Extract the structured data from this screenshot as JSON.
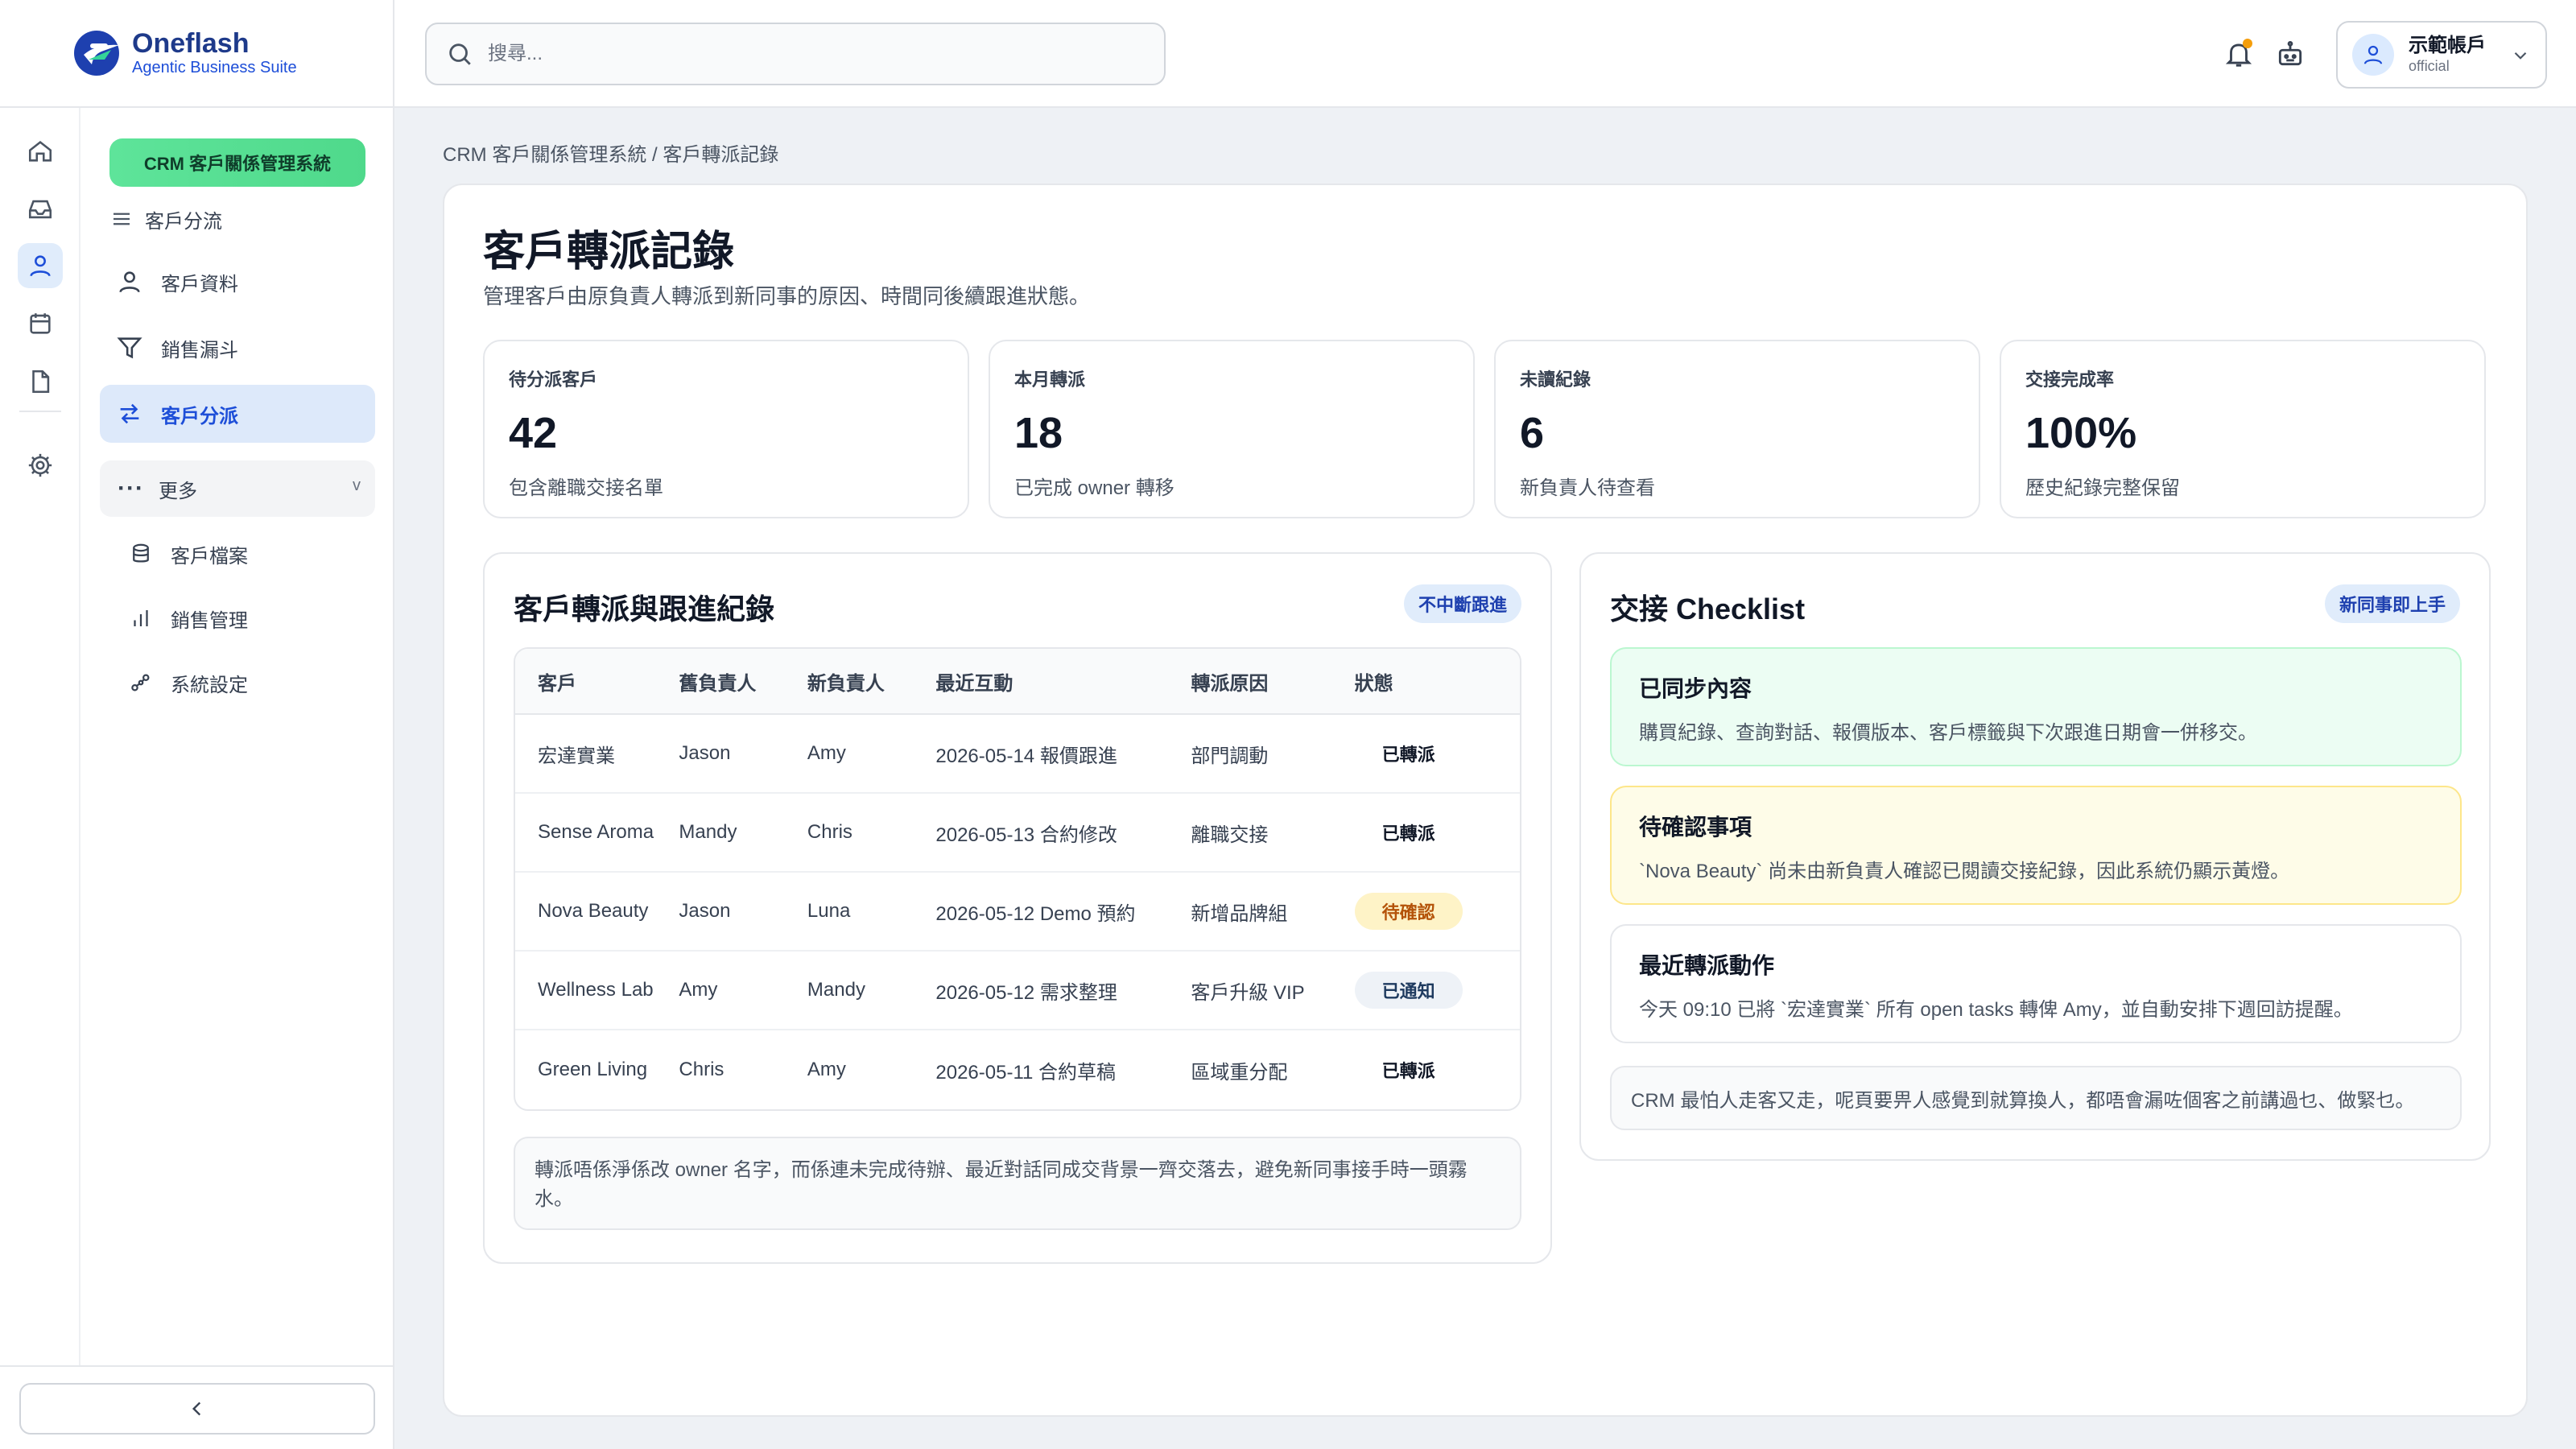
{
  "brand": {
    "name": "Oneflash",
    "tagline": "Agentic Business Suite"
  },
  "rail": {
    "icons": [
      "home-icon",
      "inbox-icon",
      "user-icon",
      "calendar-icon",
      "document-icon",
      "settings-icon"
    ],
    "active": "user-icon"
  },
  "nav": {
    "system_pill": "CRM 客戶關係管理系統",
    "group_label": "客戶分流",
    "items": [
      {
        "label": "客戶資料",
        "icon": "user-icon"
      },
      {
        "label": "銷售漏斗",
        "icon": "funnel-icon"
      },
      {
        "label": "客戶分派",
        "icon": "swap-icon",
        "active": true
      }
    ],
    "more_label": "更多",
    "more_chevron": "v",
    "sub_items": [
      {
        "label": "客戶檔案",
        "icon": "database-icon"
      },
      {
        "label": "銷售管理",
        "icon": "bar-chart-icon"
      },
      {
        "label": "系統設定",
        "icon": "workflow-icon"
      }
    ]
  },
  "search": {
    "placeholder": "搜尋..."
  },
  "account": {
    "name": "示範帳戶",
    "role": "official"
  },
  "breadcrumb": "CRM 客戶關係管理系統 / 客戶轉派記錄",
  "page": {
    "title": "客戶轉派記錄",
    "subtitle": "管理客戶由原負責人轉派到新同事的原因、時間同後續跟進狀態。"
  },
  "stats": [
    {
      "label": "待分派客戶",
      "value": "42",
      "note": "包含離職交接名單"
    },
    {
      "label": "本月轉派",
      "value": "18",
      "note": "已完成 owner 轉移"
    },
    {
      "label": "未讀紀錄",
      "value": "6",
      "note": "新負責人待查看"
    },
    {
      "label": "交接完成率",
      "value": "100%",
      "note": "歷史紀錄完整保留"
    }
  ],
  "log_panel": {
    "title": "客戶轉派與跟進紀錄",
    "badge": "不中斷跟進",
    "columns": [
      "客戶",
      "舊負責人",
      "新負責人",
      "最近互動",
      "轉派原因",
      "狀態"
    ],
    "rows": [
      {
        "customer": "宏達實業",
        "old_owner": "Jason",
        "new_owner": "Amy",
        "last": "2026-05-14 報價跟進",
        "reason": "部門調動",
        "status": "已轉派"
      },
      {
        "customer": "Sense Aroma",
        "old_owner": "Mandy",
        "new_owner": "Chris",
        "last": "2026-05-13 合約修改",
        "reason": "離職交接",
        "status": "已轉派"
      },
      {
        "customer": "Nova Beauty",
        "old_owner": "Jason",
        "new_owner": "Luna",
        "last": "2026-05-12 Demo 預約",
        "reason": "新增品牌組",
        "status": "待確認"
      },
      {
        "customer": "Wellness Lab",
        "old_owner": "Amy",
        "new_owner": "Mandy",
        "last": "2026-05-12 需求整理",
        "reason": "客戶升級 VIP",
        "status": "已通知"
      },
      {
        "customer": "Green Living",
        "old_owner": "Chris",
        "new_owner": "Amy",
        "last": "2026-05-11 合約草稿",
        "reason": "區域重分配",
        "status": "已轉派"
      }
    ],
    "note": "轉派唔係淨係改 owner 名字，而係連未完成待辦、最近對話同成交背景一齊交落去，避免新同事接手時一頭霧水。"
  },
  "checklist": {
    "title": "交接 Checklist",
    "badge": "新同事即上手",
    "items": [
      {
        "title": "已同步內容",
        "desc": "購買紀錄、查詢對話、報價版本、客戶標籤與下次跟進日期會一併移交。"
      },
      {
        "title": "待確認事項",
        "desc": "`Nova Beauty` 尚未由新負責人確認已閱讀交接紀錄，因此系統仍顯示黃燈。"
      },
      {
        "title": "最近轉派動作",
        "desc": "今天 09:10 已將 `宏達實業` 所有 open tasks 轉俾 Amy，並自動安排下週回訪提醒。"
      }
    ],
    "quote": "CRM 最怕人走客又走，呢頁要畀人感覺到就算換人，都唔會漏咗個客之前講過乜、做緊乜。"
  },
  "colors": {
    "accent": "#1d4ed8",
    "pill_green": "#4ade80",
    "pending": "#b45309"
  }
}
